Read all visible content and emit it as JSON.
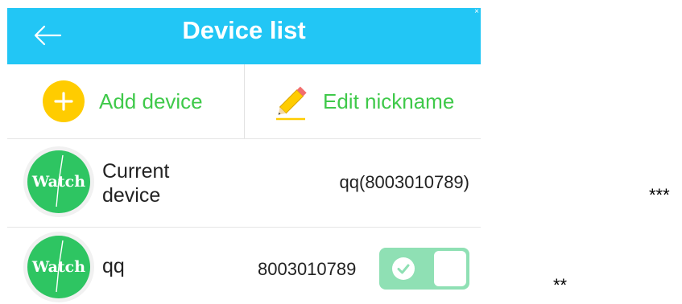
{
  "header": {
    "title": "Device list",
    "close_text": "×",
    "back_icon": "back-arrow-icon"
  },
  "actions": {
    "add_label": "Add device",
    "add_icon": "plus-circle-icon",
    "edit_label": "Edit nickname",
    "edit_icon": "pencil-icon"
  },
  "devices": [
    {
      "avatar_text": "Watch",
      "name": "Current device",
      "id_text": "qq(8003010789)"
    },
    {
      "avatar_text": "Watch",
      "name": "qq",
      "id_text": "8003010789",
      "toggle_on": true
    }
  ],
  "annotations": {
    "mark1": "***",
    "mark2": "**"
  },
  "colors": {
    "header_bg": "#22c6f5",
    "accent_green": "#3fc94a",
    "avatar_green": "#2ec562",
    "plus_yellow": "#ffcc00",
    "toggle_bg": "#8fe0b4"
  }
}
